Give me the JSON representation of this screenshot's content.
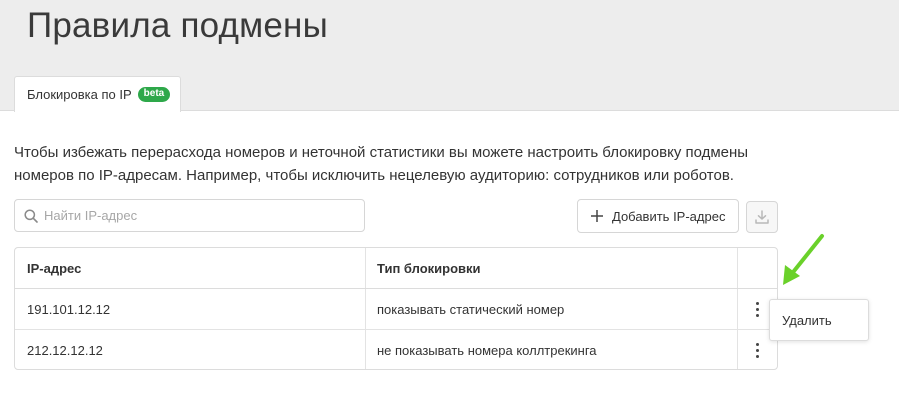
{
  "page": {
    "title": "Правила подмены"
  },
  "tabs": [
    {
      "label": "Блокировка по IP",
      "badge": "beta"
    }
  ],
  "description": "Чтобы избежать перерасхода номеров и неточной статистики вы можете настроить блокировку подмены номеров по IP-адресам. Например, чтобы исключить нецелевую аудиторию: сотрудников или роботов.",
  "search": {
    "placeholder": "Найти IP-адрес",
    "value": ""
  },
  "toolbar": {
    "add_label": "Добавить IP-адрес"
  },
  "table": {
    "columns": [
      "IP-адрес",
      "Тип блокировки"
    ],
    "rows": [
      {
        "ip": "191.101.12.12",
        "type": "показывать статический номер"
      },
      {
        "ip": "212.12.12.12",
        "type": "не показывать номера коллтрекинга"
      }
    ]
  },
  "context_menu": {
    "items": [
      {
        "label": "Удалить"
      }
    ]
  },
  "icons": {
    "search": "search-icon",
    "add": "plus-icon",
    "download": "download-icon",
    "more": "kebab-menu-icon",
    "annotation": "arrow-icon"
  },
  "colors": {
    "badge": "#2ea84a",
    "arrow": "#6ad12a",
    "header_bg": "#ededed"
  }
}
